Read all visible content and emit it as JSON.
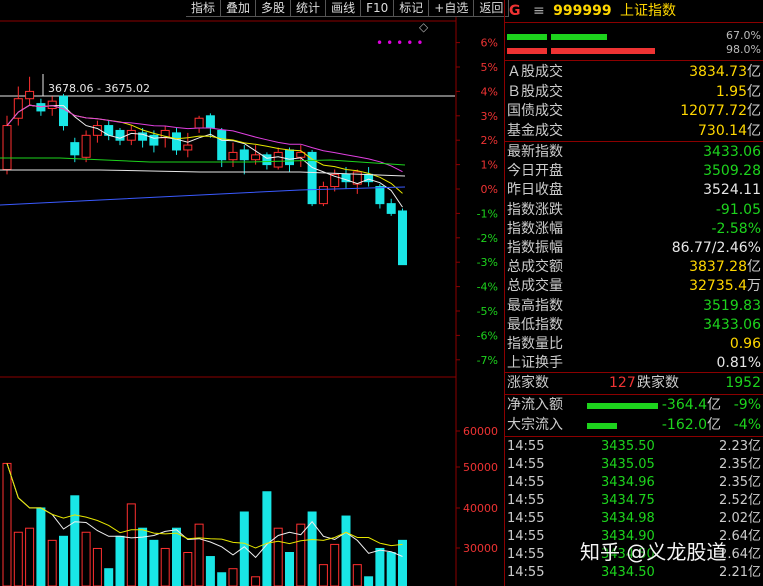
{
  "toolbar": [
    "指标",
    "叠加",
    "多股",
    "统计",
    "画线",
    "F10",
    "标记",
    "+自选",
    "返回"
  ],
  "header": {
    "g": "G",
    "eq": "≡",
    "code": "999999",
    "name": "上证指数"
  },
  "ratio_bars": {
    "top_pct": "67.0%",
    "bottom_pct": "98.0%"
  },
  "stats": [
    {
      "label": "Ａ股成交",
      "value": "3834.73",
      "unit": "亿",
      "color": "#ffd700"
    },
    {
      "label": "Ｂ股成交",
      "value": "1.95",
      "unit": "亿",
      "color": "#ffd700"
    },
    {
      "label": "国债成交",
      "value": "12077.72",
      "unit": "亿",
      "color": "#ffd700"
    },
    {
      "label": "基金成交",
      "value": "730.14",
      "unit": "亿",
      "color": "#ffd700"
    }
  ],
  "quotes": [
    {
      "label": "最新指数",
      "value": "3433.06",
      "unit": "",
      "color": "#1dd31d"
    },
    {
      "label": "今日开盘",
      "value": "3509.28",
      "unit": "",
      "color": "#1dd31d"
    },
    {
      "label": "昨日收盘",
      "value": "3524.11",
      "unit": "",
      "color": "#e6e6e6"
    },
    {
      "label": "指数涨跌",
      "value": "-91.05",
      "unit": "",
      "color": "#1dd31d"
    },
    {
      "label": "指数涨幅",
      "value": "-2.58%",
      "unit": "",
      "color": "#1dd31d"
    },
    {
      "label": "指数振幅",
      "value": "86.77/2.46%",
      "unit": "",
      "color": "#e6e6e6"
    },
    {
      "label": "总成交额",
      "value": "3837.28",
      "unit": "亿",
      "color": "#ffd700"
    },
    {
      "label": "总成交量",
      "value": "32735.4",
      "unit": "万",
      "color": "#ffd700"
    },
    {
      "label": "最高指数",
      "value": "3519.83",
      "unit": "",
      "color": "#1dd31d"
    },
    {
      "label": "最低指数",
      "value": "3433.06",
      "unit": "",
      "color": "#1dd31d"
    },
    {
      "label": "指数量比",
      "value": "0.96",
      "unit": "",
      "color": "#ffd700"
    },
    {
      "label": "上证换手",
      "value": "0.81%",
      "unit": "",
      "color": "#e6e6e6"
    }
  ],
  "breadth": {
    "up_label": "涨家数",
    "up": "127",
    "down_label": "跌家数",
    "down": "1952"
  },
  "flows": [
    {
      "label": "净流入额",
      "value": "-364.4",
      "unit": "亿",
      "pct": "-9%",
      "bar": 0.47
    },
    {
      "label": "大宗流入",
      "value": "-162.0",
      "unit": "亿",
      "pct": "-4%",
      "bar": 0.2
    }
  ],
  "ticks": [
    {
      "time": "14:55",
      "price": "3435.50",
      "vol": "2.23亿"
    },
    {
      "time": "14:55",
      "price": "3435.05",
      "vol": "2.35亿"
    },
    {
      "time": "14:55",
      "price": "3434.96",
      "vol": "2.35亿"
    },
    {
      "time": "14:55",
      "price": "3434.75",
      "vol": "2.52亿"
    },
    {
      "time": "14:55",
      "price": "3434.98",
      "vol": "2.02亿"
    },
    {
      "time": "14:55",
      "price": "3434.90",
      "vol": "2.64亿"
    },
    {
      "time": "14:55",
      "price": "3434.50",
      "vol": "2.64亿"
    },
    {
      "time": "14:55",
      "price": "3434.50",
      "vol": "2.21亿"
    }
  ],
  "chart": {
    "range_label": "3678.06 - 3675.02",
    "pct_labels": [
      "6%",
      "5%",
      "4%",
      "3%",
      "2%",
      "1%",
      "0%",
      "-1%",
      "-2%",
      "-3%",
      "-4%",
      "-5%",
      "-6%",
      "-7%"
    ],
    "vol_labels": [
      "60000",
      "50000",
      "40000",
      "30000"
    ],
    "candles": [
      {
        "o": 0.8,
        "c": 2.6,
        "h": 3.0,
        "l": 0.6
      },
      {
        "o": 2.9,
        "c": 3.7,
        "h": 4.2,
        "l": 2.6
      },
      {
        "o": 3.7,
        "c": 4.0,
        "h": 4.6,
        "l": 3.4
      },
      {
        "o": 3.5,
        "c": 3.2,
        "h": 3.7,
        "l": 3.0
      },
      {
        "o": 3.3,
        "c": 3.6,
        "h": 3.8,
        "l": 3.0
      },
      {
        "o": 3.8,
        "c": 2.6,
        "h": 3.9,
        "l": 2.4
      },
      {
        "o": 1.9,
        "c": 1.4,
        "h": 2.1,
        "l": 1.1
      },
      {
        "o": 1.3,
        "c": 2.2,
        "h": 2.4,
        "l": 1.1
      },
      {
        "o": 2.2,
        "c": 2.6,
        "h": 2.8,
        "l": 1.9
      },
      {
        "o": 2.6,
        "c": 2.2,
        "h": 2.8,
        "l": 2.0
      },
      {
        "o": 2.4,
        "c": 2.0,
        "h": 2.5,
        "l": 1.8
      },
      {
        "o": 2.0,
        "c": 2.4,
        "h": 2.6,
        "l": 1.8
      },
      {
        "o": 2.3,
        "c": 2.0,
        "h": 2.5,
        "l": 1.7
      },
      {
        "o": 2.2,
        "c": 1.8,
        "h": 2.4,
        "l": 1.5
      },
      {
        "o": 2.1,
        "c": 2.4,
        "h": 2.6,
        "l": 1.7
      },
      {
        "o": 2.3,
        "c": 1.6,
        "h": 2.5,
        "l": 1.4
      },
      {
        "o": 1.6,
        "c": 1.8,
        "h": 2.3,
        "l": 1.3
      },
      {
        "o": 2.5,
        "c": 2.9,
        "h": 3.0,
        "l": 2.3
      },
      {
        "o": 3.0,
        "c": 2.5,
        "h": 3.1,
        "l": 2.1
      },
      {
        "o": 2.4,
        "c": 1.2,
        "h": 2.5,
        "l": 0.9
      },
      {
        "o": 1.2,
        "c": 1.5,
        "h": 1.9,
        "l": 0.9
      },
      {
        "o": 1.6,
        "c": 1.2,
        "h": 1.8,
        "l": 0.6
      },
      {
        "o": 1.2,
        "c": 1.4,
        "h": 1.8,
        "l": 1.0
      },
      {
        "o": 1.4,
        "c": 1.0,
        "h": 1.5,
        "l": 0.8
      },
      {
        "o": 0.9,
        "c": 1.5,
        "h": 1.7,
        "l": 0.8
      },
      {
        "o": 1.6,
        "c": 1.0,
        "h": 1.7,
        "l": 0.7
      },
      {
        "o": 1.3,
        "c": 1.5,
        "h": 1.8,
        "l": 0.9
      },
      {
        "o": 1.5,
        "c": -0.6,
        "h": 1.6,
        "l": -0.7
      },
      {
        "o": -0.6,
        "c": 0.1,
        "h": 0.3,
        "l": -0.7
      },
      {
        "o": 0.1,
        "c": 0.6,
        "h": 0.8,
        "l": -0.1
      },
      {
        "o": 0.6,
        "c": 0.3,
        "h": 0.9,
        "l": 0.0
      },
      {
        "o": 0.2,
        "c": 0.7,
        "h": 0.8,
        "l": -0.2
      },
      {
        "o": 0.6,
        "c": 0.3,
        "h": 0.9,
        "l": 0.1
      },
      {
        "o": 0.1,
        "c": -0.6,
        "h": 0.2,
        "l": -0.8
      },
      {
        "o": -0.6,
        "c": -1.0,
        "h": -0.4,
        "l": -1.1
      },
      {
        "o": -0.9,
        "c": -3.1,
        "h": -0.8,
        "l": -3.1
      }
    ],
    "volumes": [
      52,
      35,
      36,
      41,
      33,
      34,
      44,
      35,
      31,
      26,
      34,
      42,
      36,
      33,
      31,
      36,
      30,
      37,
      29,
      25,
      26,
      40,
      24,
      45,
      36,
      30,
      37,
      40,
      27,
      32,
      39,
      27,
      24,
      31,
      30,
      33
    ]
  }
}
